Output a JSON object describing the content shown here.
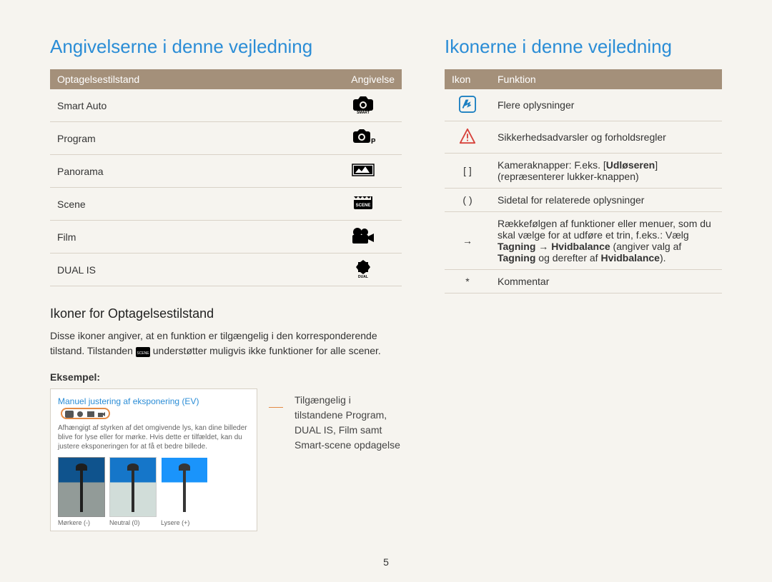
{
  "left": {
    "title": "Angivelserne i denne vejledning",
    "table": {
      "head_mode": "Optagelsestilstand",
      "head_indicator": "Angivelse",
      "rows": [
        {
          "mode": "Smart Auto",
          "icon": "smart-auto-icon"
        },
        {
          "mode": "Program",
          "icon": "program-icon"
        },
        {
          "mode": "Panorama",
          "icon": "panorama-icon"
        },
        {
          "mode": "Scene",
          "icon": "scene-icon"
        },
        {
          "mode": "Film",
          "icon": "film-icon"
        },
        {
          "mode": "DUAL IS",
          "icon": "dual-is-icon"
        }
      ]
    },
    "sub_title": "Ikoner for Optagelsestilstand",
    "body_1": "Disse ikoner angiver, at en funktion er tilgængelig i den korresponderende tilstand. Tilstanden",
    "body_2": "understøtter muligvis ikke funktioner for alle scener.",
    "example_label": "Eksempel:",
    "example_card": {
      "title": "Manuel justering af eksponering (EV)",
      "desc": "Afhængigt af styrken af det omgivende lys, kan dine billeder blive for lyse eller for mørke. Hvis dette er tilfældet, kan du justere eksponeringen for at få et bedre billede.",
      "thumbs": [
        {
          "label": "Mørkere (-)",
          "variant": "dark"
        },
        {
          "label": "Neutral (0)",
          "variant": ""
        },
        {
          "label": "Lysere (+)",
          "variant": "light"
        }
      ]
    },
    "callout": "Tilgængelig i tilstandene Program, DUAL IS, Film samt Smart-scene opdagelse"
  },
  "right": {
    "title": "Ikonerne i denne vejledning",
    "table": {
      "head_icon": "Ikon",
      "head_func": "Funktion",
      "rows": [
        {
          "icon": "info-icon",
          "text": "Flere oplysninger"
        },
        {
          "icon": "warning-icon",
          "text": "Sikkerhedsadvarsler og forholdsregler"
        },
        {
          "icon_text": "[  ]",
          "html": "Kameraknapper: F.eks. [<b>Udløseren</b>] (repræsenterer lukker-knappen)"
        },
        {
          "icon_text": "(  )",
          "text": "Sidetal for relaterede oplysninger"
        },
        {
          "icon_text": "→",
          "html": "Rækkefølgen af funktioner eller menuer, som du skal vælge for at udføre et trin, f.eks.: Vælg <b>Tagning</b> → <b>Hvidbalance</b> (angiver valg af <b>Tagning</b> og derefter af <b>Hvidbalance</b>)."
        },
        {
          "icon_text": "*",
          "text": "Kommentar"
        }
      ]
    }
  },
  "page_number": "5"
}
